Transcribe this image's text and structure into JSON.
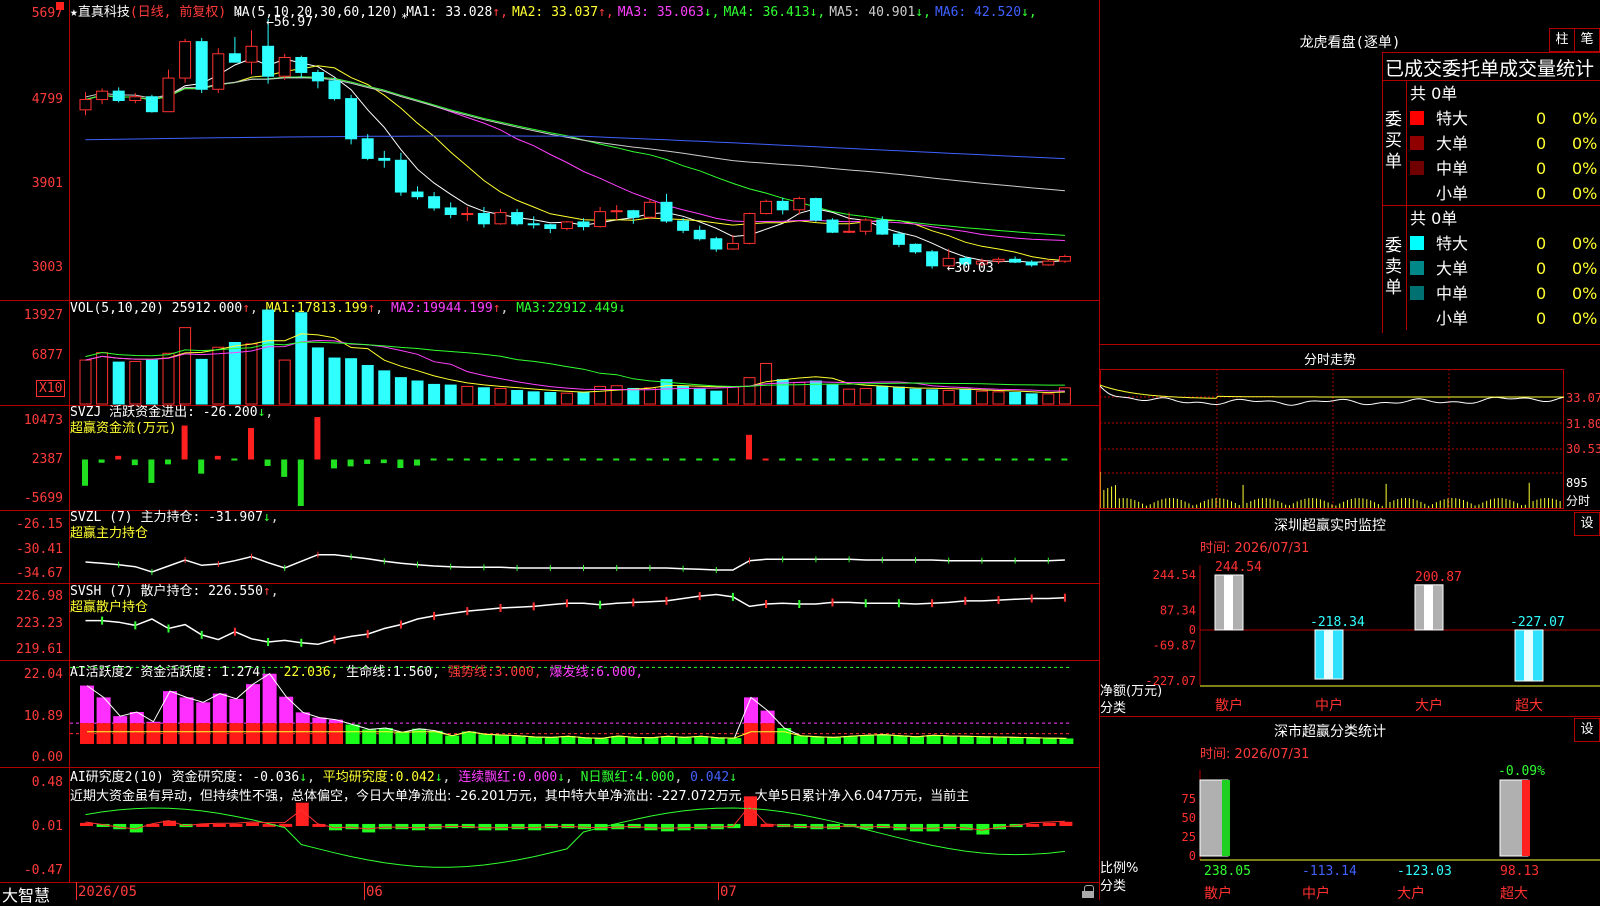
{
  "stock": {
    "name": "直真科技",
    "period": "(日线, 前复权)"
  },
  "main_chart": {
    "y_labels": [
      "5697",
      "4799",
      "3901",
      "3003"
    ],
    "high_label": "56.97",
    "low_label": "30.03",
    "ma_params": "MA(5,10,20,30,60,120)",
    "ma": [
      {
        "label": "MA1:",
        "value": "33.028",
        "arrow": "↑",
        "color": "#ffffff"
      },
      {
        "label": "MA2:",
        "value": "33.037",
        "arrow": "↑",
        "color": "#ffff30"
      },
      {
        "label": "MA3:",
        "value": "35.063",
        "arrow": "↓",
        "color": "#ff40ff"
      },
      {
        "label": "MA4:",
        "value": "36.413",
        "arrow": "↓",
        "color": "#30ff30"
      },
      {
        "label": "MA5:",
        "value": "40.901",
        "arrow": "↓",
        "color": "#cccccc"
      },
      {
        "label": "MA6:",
        "value": "42.520",
        "arrow": "↓",
        "color": "#4060ff"
      }
    ],
    "candles": [
      [
        47.2,
        49.1,
        46.6,
        48.3
      ],
      [
        48.3,
        49.5,
        47.8,
        49.2
      ],
      [
        49.2,
        49.6,
        48.0,
        48.2
      ],
      [
        48.2,
        49.0,
        47.9,
        48.6
      ],
      [
        48.6,
        48.8,
        46.9,
        47.0
      ],
      [
        47.0,
        51.5,
        47.0,
        50.6
      ],
      [
        50.6,
        54.8,
        50.1,
        54.5
      ],
      [
        54.5,
        54.9,
        49.0,
        49.4
      ],
      [
        49.4,
        53.8,
        49.0,
        53.2
      ],
      [
        53.2,
        55.0,
        52.4,
        52.3
      ],
      [
        52.3,
        55.7,
        51.0,
        54.0
      ],
      [
        54.0,
        56.97,
        50.0,
        50.8
      ],
      [
        50.8,
        53.2,
        50.4,
        52.8
      ],
      [
        52.8,
        53.0,
        50.6,
        51.2
      ],
      [
        51.2,
        51.5,
        49.5,
        50.3
      ],
      [
        50.3,
        50.6,
        48.2,
        48.4
      ],
      [
        48.4,
        48.8,
        43.5,
        44.1
      ],
      [
        44.1,
        44.6,
        41.8,
        42.0
      ],
      [
        42.0,
        42.8,
        41.0,
        41.8
      ],
      [
        41.8,
        42.6,
        38.0,
        38.4
      ],
      [
        38.4,
        39.0,
        37.6,
        37.9
      ],
      [
        37.9,
        38.4,
        36.4,
        36.7
      ],
      [
        36.7,
        37.3,
        35.6,
        36.0
      ],
      [
        36.0,
        36.8,
        35.3,
        36.1
      ],
      [
        36.1,
        36.8,
        34.6,
        35.0
      ],
      [
        35.0,
        36.6,
        34.9,
        36.2
      ],
      [
        36.2,
        36.6,
        34.8,
        35.0
      ],
      [
        35.0,
        35.8,
        34.5,
        34.9
      ],
      [
        34.9,
        35.0,
        34.0,
        34.5
      ],
      [
        34.5,
        35.3,
        34.3,
        35.2
      ],
      [
        35.2,
        35.6,
        34.3,
        34.7
      ],
      [
        34.7,
        36.8,
        34.6,
        36.3
      ],
      [
        36.3,
        37.0,
        35.4,
        36.4
      ],
      [
        36.4,
        36.5,
        35.0,
        35.7
      ],
      [
        35.7,
        37.6,
        35.5,
        37.3
      ],
      [
        37.3,
        38.2,
        35.1,
        35.3
      ],
      [
        35.3,
        35.6,
        34.0,
        34.3
      ],
      [
        34.3,
        34.8,
        33.2,
        33.4
      ],
      [
        33.4,
        33.6,
        32.0,
        32.3
      ],
      [
        32.3,
        33.8,
        32.2,
        32.9
      ],
      [
        32.9,
        36.2,
        32.8,
        36.1
      ],
      [
        36.1,
        37.6,
        36.0,
        37.4
      ],
      [
        37.4,
        37.8,
        36.0,
        36.5
      ],
      [
        36.5,
        37.9,
        36.0,
        37.7
      ],
      [
        37.7,
        37.8,
        35.2,
        35.4
      ],
      [
        35.4,
        35.6,
        34.0,
        34.1
      ],
      [
        34.1,
        36.2,
        34.0,
        34.2
      ],
      [
        34.2,
        35.6,
        33.8,
        35.4
      ],
      [
        35.4,
        35.8,
        33.8,
        33.9
      ],
      [
        33.9,
        34.2,
        32.5,
        32.8
      ],
      [
        32.8,
        32.9,
        31.8,
        32.0
      ],
      [
        32.0,
        32.2,
        30.2,
        30.5
      ],
      [
        30.5,
        32.3,
        30.03,
        31.3
      ],
      [
        31.3,
        31.5,
        30.5,
        30.7
      ],
      [
        30.7,
        31.3,
        30.4,
        31.0
      ],
      [
        31.0,
        31.4,
        30.7,
        31.2
      ],
      [
        31.2,
        31.5,
        30.8,
        30.9
      ],
      [
        30.9,
        31.1,
        30.4,
        30.6
      ],
      [
        30.6,
        31.2,
        30.5,
        31.0
      ],
      [
        31.0,
        31.7,
        30.8,
        31.5
      ]
    ]
  },
  "vol": {
    "y_labels": [
      "13927",
      "6877"
    ],
    "unit": "X10",
    "params": "VOL(5,10,20)",
    "value": "25912.000",
    "ma1_label": "MA1:",
    "ma1": "17813.199",
    "ma2_label": "MA2:",
    "ma2": "19944.199",
    "ma3_label": "MA3:",
    "ma3": "22912.449",
    "values": [
      6500,
      7600,
      6200,
      6300,
      6500,
      7500,
      11300,
      6600,
      8400,
      9100,
      8900,
      13900,
      6500,
      13500,
      8300,
      6800,
      6700,
      5700,
      4900,
      3900,
      3400,
      2900,
      2800,
      2600,
      2400,
      2300,
      2000,
      1800,
      1700,
      1600,
      1700,
      2600,
      2700,
      2300,
      2400,
      3600,
      2600,
      2200,
      1900,
      2500,
      3900,
      6000,
      3600,
      3200,
      3400,
      2800,
      2200,
      2300,
      2600,
      2500,
      2200,
      2100,
      2000,
      2200,
      1900,
      1800,
      1700,
      1500,
      1500,
      2400
    ]
  },
  "svzj": {
    "y_labels": [
      "10473",
      "2387",
      "-5699"
    ],
    "title": "SVZJ",
    "metric": "活跃资金进出:",
    "value": "-26.200",
    "subtitle": "超赢资金流(万元)",
    "values": [
      -6500,
      -800,
      900,
      -1400,
      -5800,
      -1200,
      8400,
      -3500,
      900,
      -700,
      7800,
      -1600,
      -4300,
      -11500,
      10500,
      -2200,
      -1700,
      -1100,
      -900,
      -2100,
      -1500,
      -700,
      -700,
      -500,
      -600,
      -500,
      -300,
      -400,
      -300,
      -500,
      -400,
      -300,
      -300,
      -300,
      -400,
      -300,
      -200,
      -200,
      -200,
      -200,
      6100,
      400,
      -200,
      -200,
      -200,
      -200,
      -300,
      -200,
      -200,
      -300,
      -200,
      -200,
      -200,
      -200,
      -200,
      -200,
      -200,
      -200,
      -200,
      -200
    ]
  },
  "svzl": {
    "y_labels": [
      "-26.15",
      "-30.41",
      "-34.67"
    ],
    "title": "SVZL (7)",
    "metric": "主力持仓:",
    "value": "-31.907",
    "subtitle": "超赢主力持仓",
    "values": [
      -32.5,
      -32.7,
      -32.9,
      -33.2,
      -34.0,
      -33.1,
      -32.2,
      -33.0,
      -32.8,
      -32.3,
      -31.7,
      -32.6,
      -33.4,
      -32.4,
      -31.4,
      -31.4,
      -31.7,
      -32.0,
      -32.4,
      -32.7,
      -32.9,
      -33.1,
      -33.2,
      -33.3,
      -33.3,
      -33.3,
      -33.4,
      -33.4,
      -33.4,
      -33.4,
      -33.4,
      -33.4,
      -33.4,
      -33.4,
      -33.4,
      -33.4,
      -33.5,
      -33.6,
      -33.7,
      -33.7,
      -32.3,
      -32.1,
      -32.1,
      -32.1,
      -32.1,
      -32.1,
      -32.1,
      -32.2,
      -32.2,
      -32.2,
      -32.2,
      -32.2,
      -32.3,
      -32.3,
      -32.3,
      -32.3,
      -32.3,
      -32.3,
      -32.3,
      -32.2
    ]
  },
  "svsh": {
    "y_labels": [
      "226.98",
      "223.23",
      "219.61"
    ],
    "title": "SVSH (7)",
    "metric": "散户持仓:",
    "value": "226.550",
    "subtitle": "超赢散户持仓",
    "values": [
      223.6,
      223.6,
      223.4,
      223.0,
      223.8,
      222.6,
      223.1,
      221.8,
      221.2,
      222.2,
      221.3,
      220.9,
      221.1,
      220.8,
      220.6,
      221.2,
      221.6,
      221.9,
      222.6,
      223.1,
      223.8,
      224.2,
      224.5,
      224.8,
      225.0,
      225.2,
      225.3,
      225.4,
      225.6,
      225.8,
      225.8,
      225.6,
      225.8,
      225.9,
      226.0,
      226.1,
      226.4,
      226.7,
      226.9,
      226.6,
      225.4,
      225.7,
      225.8,
      225.7,
      225.7,
      225.9,
      225.9,
      225.8,
      225.8,
      225.8,
      225.7,
      225.8,
      225.9,
      226.1,
      226.1,
      226.2,
      226.3,
      226.4,
      226.4,
      226.5
    ]
  },
  "ai_active": {
    "y_labels": [
      "22.04",
      "10.89",
      "0.00"
    ],
    "title": "AI活跃度2",
    "metric": "资金活跃度:",
    "value": "1.274",
    "extra": "22.036,",
    "life_label": "生命线:",
    "life": "1.560,",
    "strong_label": "强势线:",
    "strong": "3.000,",
    "burst_label": "爆发线:",
    "burst": "6.000,",
    "values": [
      16.8,
      13.4,
      8.0,
      9.2,
      6.4,
      15.2,
      13.4,
      12.0,
      14.5,
      13.0,
      17.2,
      20.2,
      13.6,
      9.1,
      7.6,
      7.0,
      5.6,
      4.2,
      4.6,
      3.4,
      4.4,
      3.8,
      2.4,
      3.6,
      2.8,
      2.6,
      2.4,
      2.0,
      1.9,
      2.2,
      1.8,
      1.6,
      2.3,
      1.9,
      1.8,
      2.2,
      1.9,
      2.2,
      1.8,
      1.7,
      13.4,
      9.6,
      4.6,
      2.4,
      2.1,
      1.9,
      2.2,
      2.5,
      2.7,
      2.4,
      2.1,
      2.5,
      2.3,
      2.2,
      2.1,
      2.0,
      1.9,
      1.8,
      1.7,
      1.6
    ]
  },
  "ai_research": {
    "y_labels": [
      "0.48",
      "0.01",
      "-0.47"
    ],
    "title": "AI研究度2(10)",
    "metric": "资金研究度:",
    "value": "-0.036",
    "avg_label": "平均研究度:",
    "avg": "0.042",
    "red_label": "连续飘红:",
    "red": "0.000",
    "n_label": "N日飘红:",
    "n": "4.000",
    "last": "0.042",
    "text": "近期大资金虽有异动，但持续性不强，总体偏空，今日大单净流出: -26.201万元，其中特大单净流出: -227.072万元，大单5日累计净入6.047万元，当前主",
    "values": [
      0.03,
      -0.01,
      -0.05,
      -0.08,
      0.0,
      0.05,
      -0.03,
      0.0,
      0.01,
      0.01,
      0.03,
      0.02,
      0.02,
      0.22,
      0.0,
      -0.06,
      -0.05,
      -0.08,
      -0.05,
      -0.05,
      -0.06,
      -0.05,
      -0.04,
      -0.04,
      -0.06,
      -0.06,
      -0.05,
      -0.06,
      -0.04,
      -0.04,
      -0.05,
      -0.06,
      -0.05,
      -0.04,
      -0.06,
      -0.07,
      -0.06,
      -0.05,
      -0.05,
      -0.04,
      0.28,
      0.0,
      -0.03,
      -0.04,
      -0.05,
      -0.05,
      -0.03,
      -0.05,
      -0.04,
      -0.06,
      -0.07,
      -0.07,
      -0.05,
      -0.06,
      -0.1,
      -0.05,
      -0.03,
      0.02,
      0.03,
      0.04
    ]
  },
  "x_axis": {
    "brand": "大智慧",
    "dates": [
      "2026/05",
      "06",
      "07"
    ]
  },
  "lhb": {
    "title": "龙虎看盘(逐单)",
    "btn_zhu": "柱",
    "btn_bi": "笔",
    "subtitle": "已成交委托单成交量统计",
    "buy_label": "委买单",
    "sell_label": "委卖单",
    "buy_total": "共 0单",
    "sell_total": "共 0单",
    "buy_rows": [
      {
        "name": "特大",
        "count": "0",
        "pct": "0%",
        "color": "#ff0000"
      },
      {
        "name": "大单",
        "count": "0",
        "pct": "0%",
        "color": "#900000"
      },
      {
        "name": "中单",
        "count": "0",
        "pct": "0%",
        "color": "#700000"
      },
      {
        "name": "小单",
        "count": "0",
        "pct": "0%",
        "color": "#000000"
      }
    ],
    "sell_rows": [
      {
        "name": "特大",
        "count": "0",
        "pct": "0%",
        "color": "#00ffff"
      },
      {
        "name": "大单",
        "count": "0",
        "pct": "0%",
        "color": "#008888"
      },
      {
        "name": "中单",
        "count": "0",
        "pct": "0%",
        "color": "#007070"
      },
      {
        "name": "小单",
        "count": "0",
        "pct": "0%",
        "color": "#000000"
      }
    ]
  },
  "fenshi": {
    "title": "分时走势",
    "y_labels": [
      "33.07",
      "31.80",
      "30.53",
      "895",
      "分时"
    ]
  },
  "sz_monitor": {
    "title": "深圳超赢实时监控",
    "btn": "设",
    "time": "时间: 2026/07/31",
    "y_labels": [
      "244.54",
      "87.34",
      "0",
      "-69.87",
      "-227.07"
    ],
    "ylabel": "净额(万元)",
    "xlabel": "分类",
    "categories": [
      "散户",
      "中户",
      "大户",
      "超大"
    ],
    "values": [
      244.54,
      -218.34,
      200.87,
      -227.07
    ],
    "value_labels": [
      "244.54",
      "-218.34",
      "200.87",
      "-227.07"
    ]
  },
  "sz_class": {
    "title": "深市超赢分类统计",
    "btn": "设",
    "time": "时间: 2026/07/31",
    "y_labels": [
      "75",
      "50",
      "25",
      "0"
    ],
    "ylabel": "比例%",
    "xlabel": "分类",
    "top_label": "-0.09%",
    "categories": [
      "散户",
      "中户",
      "大户",
      "超大"
    ],
    "values": [
      "238.05",
      "-113.14",
      "-123.03",
      "98.13"
    ]
  }
}
